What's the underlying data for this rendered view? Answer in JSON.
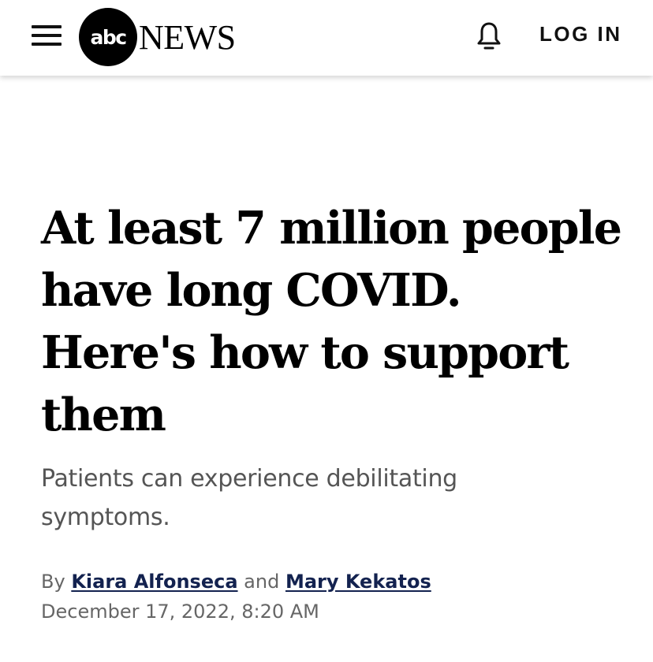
{
  "header": {
    "logo": {
      "abc_text": "abc",
      "news_text": "NEWS"
    },
    "menu_icon": "hamburger-menu-icon",
    "notification_icon": "bell-icon",
    "login_label": "LOG IN"
  },
  "article": {
    "headline": "At least 7 million people have long COVID. Here's how to support them",
    "dek": "Patients can experience debilitating symptoms.",
    "byline": {
      "prefix": "By",
      "author_1": "Kiara Alfonseca",
      "conjunction": "and",
      "author_2": "Mary Kekatos"
    },
    "date": "December 17, 2022, 8:20 AM"
  },
  "colors": {
    "author_link": "#13224f",
    "secondary_text": "#666666"
  }
}
